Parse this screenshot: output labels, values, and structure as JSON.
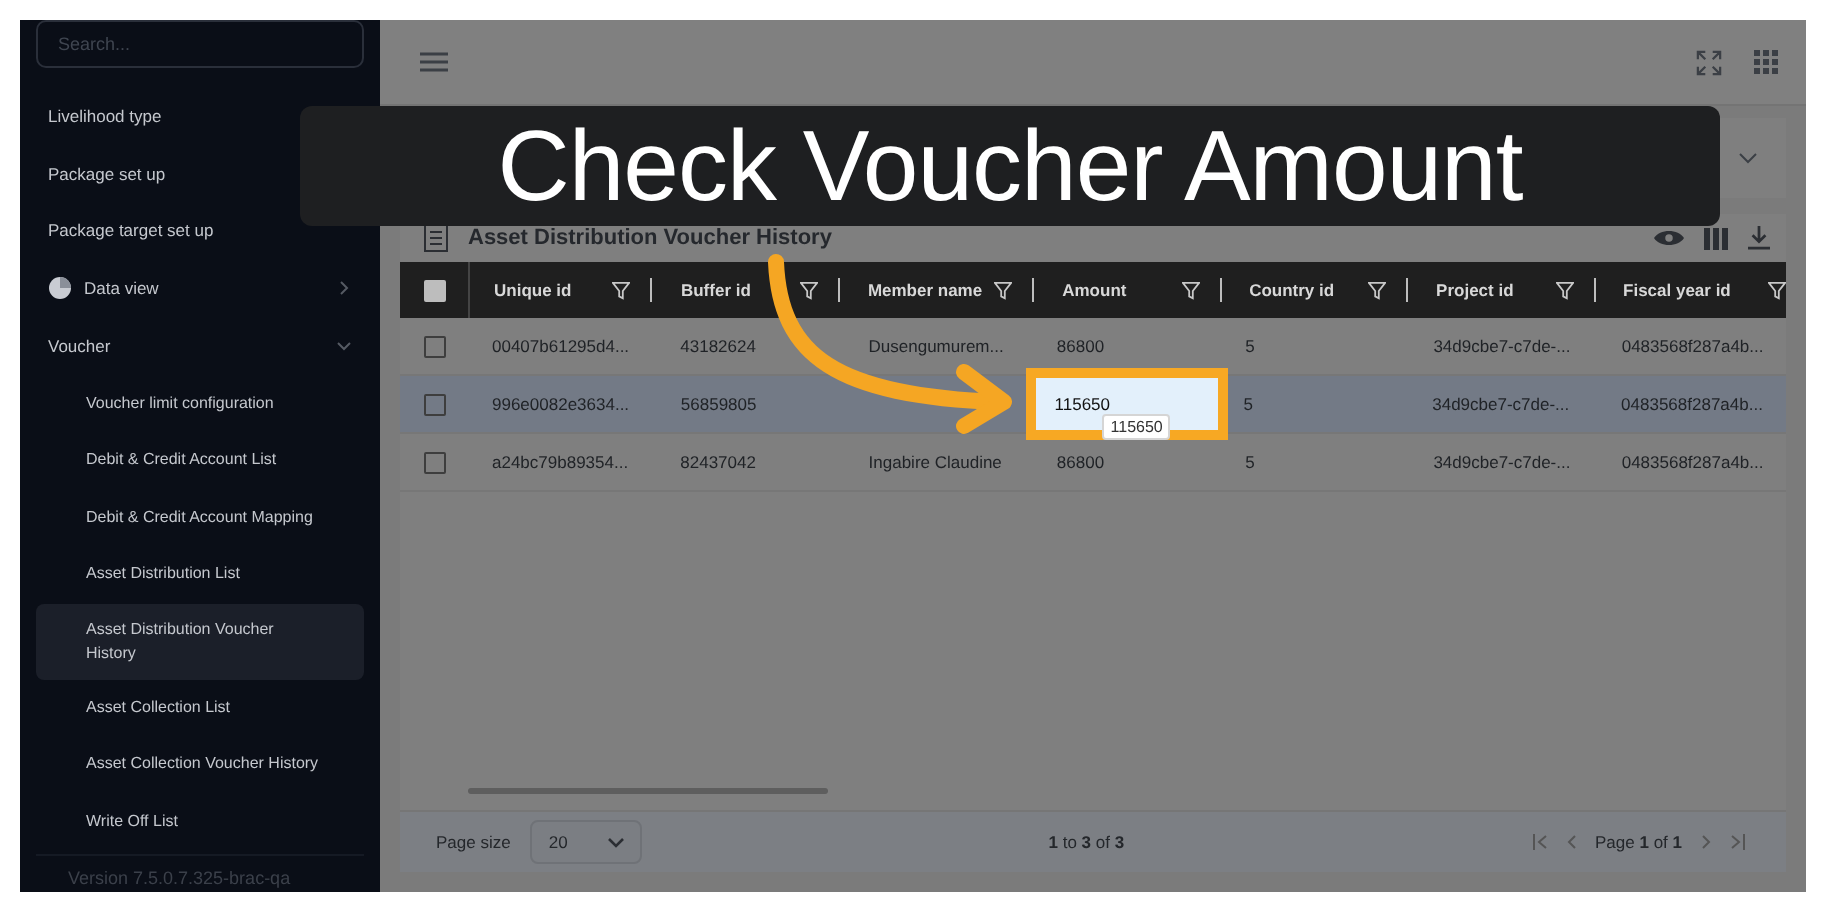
{
  "sidebar": {
    "search": {
      "placeholder": "Search..."
    },
    "items": [
      {
        "kind": "link",
        "label": "Livelihood type",
        "selected": false
      },
      {
        "kind": "link",
        "label": "Package set up",
        "selected": false
      },
      {
        "kind": "link",
        "label": "Package target set up",
        "selected": false
      },
      {
        "kind": "group",
        "label": "Data view",
        "expanded": false
      },
      {
        "kind": "group",
        "label": "Voucher",
        "expanded": true,
        "children": [
          {
            "label": "Voucher limit configuration",
            "selected": false
          },
          {
            "label": "Debit & Credit Account List",
            "selected": false
          },
          {
            "label": "Debit & Credit Account Mapping",
            "selected": false
          },
          {
            "label": "Asset Distribution List",
            "selected": false
          },
          {
            "label": "Asset Distribution Voucher History",
            "selected": true
          },
          {
            "label": "Asset Collection List",
            "selected": false
          },
          {
            "label": "Asset Collection Voucher History",
            "selected": false
          },
          {
            "label": "Write Off List",
            "selected": false
          }
        ]
      }
    ],
    "version": "Version 7.5.0.7.325-brac-qa"
  },
  "annotation": {
    "caption": "Check Voucher Amount",
    "tooltip": "115650"
  },
  "table": {
    "title": "Asset Distribution Voucher History",
    "header_checkbox": {
      "checked": false
    },
    "columns": [
      {
        "label": "Unique id",
        "highlighted": false
      },
      {
        "label": "Buffer id",
        "highlighted": false
      },
      {
        "label": "Member name",
        "highlighted": false
      },
      {
        "label": "Amount",
        "highlighted": true
      },
      {
        "label": "Country id",
        "highlighted": false
      },
      {
        "label": "Project id",
        "highlighted": false
      },
      {
        "label": "Fiscal year id",
        "highlighted": false
      }
    ],
    "rows": [
      {
        "selected": false,
        "checked": false,
        "cells": [
          "00407b61295d4...",
          "43182624",
          "Dusengumurem...",
          "86800",
          "5",
          "34d9cbe7-c7de-...",
          "0483568f287a4b..."
        ]
      },
      {
        "selected": true,
        "checked": false,
        "cells": [
          "996e0082e3634...",
          "56859805",
          "",
          "115650",
          "5",
          "34d9cbe7-c7de-...",
          "0483568f287a4b..."
        ]
      },
      {
        "selected": false,
        "checked": false,
        "cells": [
          "a24bc79b89354...",
          "82437042",
          "Ingabire Claudine",
          "86800",
          "5",
          "34d9cbe7-c7de-...",
          "0483568f287a4b..."
        ]
      }
    ]
  },
  "footer": {
    "page_size_label": "Page size",
    "page_size": "20",
    "range": "**1** to **3** of **3**",
    "page": "Page **1** of **1**"
  }
}
